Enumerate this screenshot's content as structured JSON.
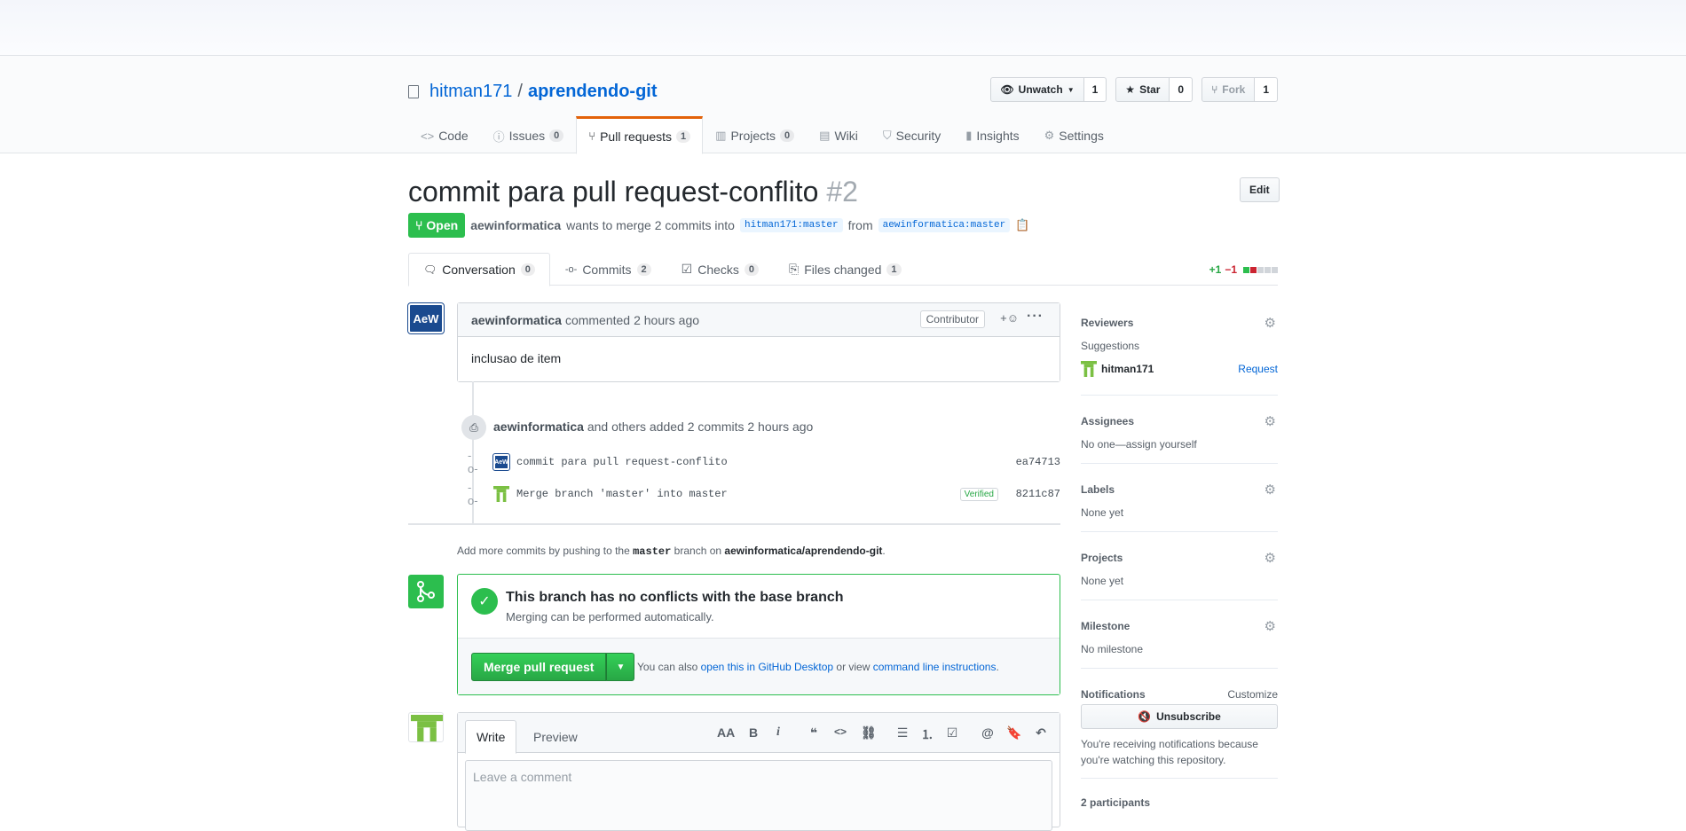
{
  "repo": {
    "owner": "hitman171",
    "separator": "/",
    "name": "aprendendo-git"
  },
  "actions": {
    "watch": {
      "label": "Unwatch",
      "count": "1"
    },
    "star": {
      "label": "Star",
      "count": "0"
    },
    "fork": {
      "label": "Fork",
      "count": "1"
    }
  },
  "reponav": [
    {
      "label": "Code",
      "icon": "<>",
      "counter": ""
    },
    {
      "label": "Issues",
      "icon": "ⓘ",
      "counter": "0"
    },
    {
      "label": "Pull requests",
      "icon": "⑂",
      "counter": "1"
    },
    {
      "label": "Projects",
      "icon": "▥",
      "counter": "0"
    },
    {
      "label": "Wiki",
      "icon": "▤",
      "counter": ""
    },
    {
      "label": "Security",
      "icon": "⛉",
      "counter": ""
    },
    {
      "label": "Insights",
      "icon": "▮",
      "counter": ""
    },
    {
      "label": "Settings",
      "icon": "⚙",
      "counter": ""
    }
  ],
  "pr": {
    "title": "commit para pull request-conflito",
    "number": "#2",
    "edit_label": "Edit",
    "state": "Open",
    "author": "aewinformatica",
    "merge_text": "wants to merge 2 commits into",
    "base_branch": "hitman171:master",
    "from_text": "from",
    "head_branch": "aewinformatica:master"
  },
  "tabs": [
    {
      "label": "Conversation",
      "counter": "0",
      "icon": "🗨"
    },
    {
      "label": "Commits",
      "counter": "2",
      "icon": "-o-"
    },
    {
      "label": "Checks",
      "counter": "0",
      "icon": "☑"
    },
    {
      "label": "Files changed",
      "counter": "1",
      "icon": "⎘"
    }
  ],
  "diffstat": {
    "additions": "+1",
    "deletions": "−1"
  },
  "comment": {
    "author": "aewinformatica",
    "action": "commented",
    "time": "2 hours ago",
    "badge": "Contributor",
    "reaction": "+☺",
    "body": "inclusao de item"
  },
  "commits_summary": {
    "author": "aewinformatica",
    "text": "and others added 2 commits",
    "time": "2 hours ago"
  },
  "commits": [
    {
      "message": "commit para pull request-conflito",
      "sha": "ea74713",
      "verified": ""
    },
    {
      "message": "Merge branch 'master' into master",
      "sha": "8211c87",
      "verified": "Verified"
    }
  ],
  "push_hint": {
    "prefix": "Add more commits by pushing to the",
    "branch": "master",
    "middle": "branch on",
    "repo": "aewinformatica/aprendendo-git",
    "suffix": "."
  },
  "merge": {
    "heading": "This branch has no conflicts with the base branch",
    "sub": "Merging can be performed automatically.",
    "button": "Merge pull request",
    "alt_prefix": "You can also",
    "alt_link1": "open this in GitHub Desktop",
    "alt_mid": "or view",
    "alt_link2": "command line instructions",
    "alt_suffix": "."
  },
  "editor": {
    "write_tab": "Write",
    "preview_tab": "Preview",
    "placeholder": "Leave a comment",
    "tools": [
      "AA",
      "B",
      "i",
      "❝",
      "<>",
      "⛓",
      "☰",
      "⒈",
      "☑",
      "@",
      "🔖",
      "↶"
    ]
  },
  "sidebar": {
    "reviewers": {
      "title": "Reviewers",
      "suggestions": "Suggestions",
      "user": "hitman171",
      "request": "Request"
    },
    "assignees": {
      "title": "Assignees",
      "text": "No one—assign yourself"
    },
    "labels": {
      "title": "Labels",
      "text": "None yet"
    },
    "projects": {
      "title": "Projects",
      "text": "None yet"
    },
    "milestone": {
      "title": "Milestone",
      "text": "No milestone"
    },
    "notifications": {
      "title": "Notifications",
      "customize": "Customize",
      "button": "Unsubscribe",
      "text1": "You're receiving notifications because",
      "text2": "you're watching this repository."
    },
    "participants": "2 participants"
  },
  "colors": {
    "accent": "#0366d6",
    "open": "#2cbe4e",
    "selected_tab": "#e36209"
  }
}
